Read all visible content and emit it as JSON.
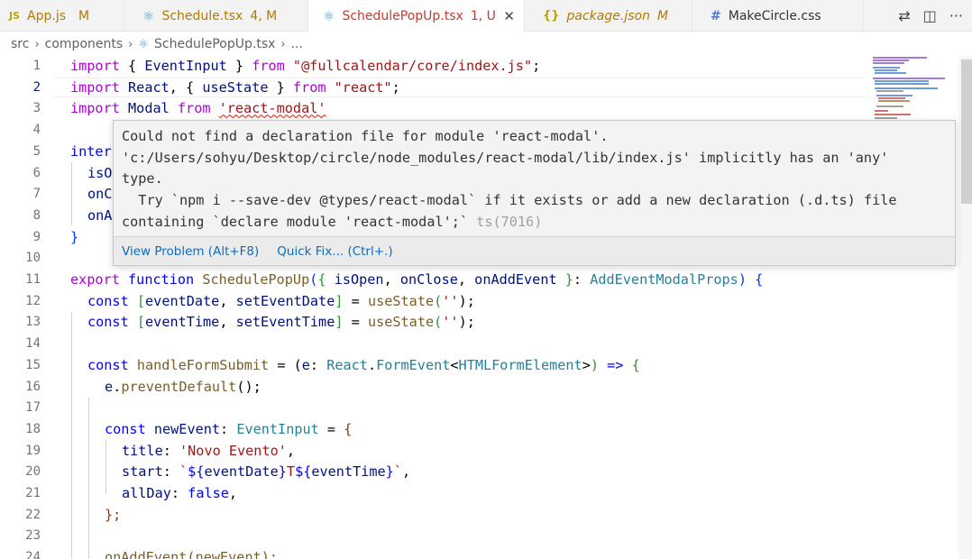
{
  "tabs": [
    {
      "icon": "JS",
      "name": "App.js",
      "status": "M",
      "close": "",
      "icon_color": "#b8a600",
      "name_color": "#b07a00"
    },
    {
      "icon": "⚛",
      "name": "Schedule.tsx",
      "status": "4, M",
      "close": "",
      "icon_color": "#4d9dd1",
      "name_color": "#b07a00"
    },
    {
      "icon": "⚛",
      "name": "SchedulePopUp.tsx",
      "status": "1, U",
      "close": "✕",
      "icon_color": "#4d9dd1",
      "name_color": "#c13b2f"
    },
    {
      "icon": "{}",
      "name": "package.json",
      "status": "M",
      "close": "",
      "icon_color": "#b8a600",
      "name_color": "#b07a00"
    },
    {
      "icon": "#",
      "name": "MakeCircle.css",
      "status": "",
      "close": "",
      "icon_color": "#4d79d1",
      "name_color": "#333333"
    }
  ],
  "tab_actions": {
    "compare_icon": "⇄",
    "split_icon": "◫",
    "more_icon": "···"
  },
  "breadcrumb": {
    "src": "src",
    "components": "components",
    "file": "SchedulePopUp.tsx",
    "more": "..."
  },
  "editor": {
    "line_numbers": [
      "1",
      "2",
      "3",
      "4",
      "5",
      "6",
      "7",
      "8",
      "9",
      "10",
      "11",
      "12",
      "13",
      "14",
      "15",
      "16",
      "17",
      "18",
      "19",
      "20",
      "21",
      "22",
      "23",
      "24"
    ],
    "lines": {
      "l1": [
        "import",
        " { ",
        "EventInput",
        " } ",
        "from",
        " ",
        "\"@fullcalendar/core/index.js\"",
        ";"
      ],
      "l2": [
        "import",
        " ",
        "React",
        ", { ",
        "useState",
        " } ",
        "from",
        " ",
        "\"react\"",
        ";"
      ],
      "l3": [
        "import",
        " ",
        "Modal",
        " ",
        "from",
        " ",
        "'react-modal'"
      ],
      "l5": [
        "inter"
      ],
      "l6": [
        "isO"
      ],
      "l7": [
        "onC"
      ],
      "l8": [
        "onA"
      ],
      "l9": [
        "}"
      ],
      "l11": [
        "export",
        " ",
        "function",
        " ",
        "SchedulePopUp",
        "(",
        "{",
        " ",
        "isOpen",
        ", ",
        "onClose",
        ", ",
        "onAddEvent",
        " ",
        "}",
        ": ",
        "AddEventModalProps",
        ") ",
        "{"
      ],
      "l12": [
        "const",
        " ",
        "[",
        "eventDate",
        ", ",
        "setEventDate",
        "]",
        " = ",
        "useState",
        "(",
        "''",
        ");"
      ],
      "l13": [
        "const",
        " ",
        "[",
        "eventTime",
        ", ",
        "setEventTime",
        "]",
        " = ",
        "useState",
        "(",
        "''",
        ");"
      ],
      "l15": [
        "const",
        " ",
        "handleFormSubmit",
        " = (",
        "e",
        ": ",
        "React",
        ".",
        "FormEvent",
        "<",
        "HTMLFormElement",
        ">",
        ") ",
        "=>",
        " {"
      ],
      "l16": [
        "e",
        ".",
        "preventDefault",
        "();"
      ],
      "l18": [
        "const",
        " ",
        "newEvent",
        ": ",
        "EventInput",
        " = ",
        "{"
      ],
      "l19": [
        "title",
        ": ",
        "'Novo Evento'",
        ","
      ],
      "l20": [
        "start",
        ": ",
        "`",
        "${",
        "eventDate",
        "}",
        "T",
        "${",
        "eventTime",
        "}",
        "`",
        ","
      ],
      "l21": [
        "allDay",
        ": ",
        "false",
        ","
      ],
      "l22": [
        "};"
      ],
      "l24": [
        "onAddEvent(newEvent);"
      ]
    }
  },
  "hover": {
    "message_line1": "Could not find a declaration file for module 'react-modal'.",
    "message_line2": "'c:/Users/sohyu/Desktop/circle/node_modules/react-modal/lib/index.js' implicitly has an 'any'",
    "message_line3": "type.",
    "message_line4": "  Try `npm i --save-dev @types/react-modal` if it exists or add a new declaration (.d.ts) file",
    "message_line5": "containing `declare module 'react-modal';`",
    "error_code": " ts(7016)",
    "view_problem": "View Problem (Alt+F8)",
    "quick_fix": "Quick Fix... (Ctrl+.)"
  }
}
